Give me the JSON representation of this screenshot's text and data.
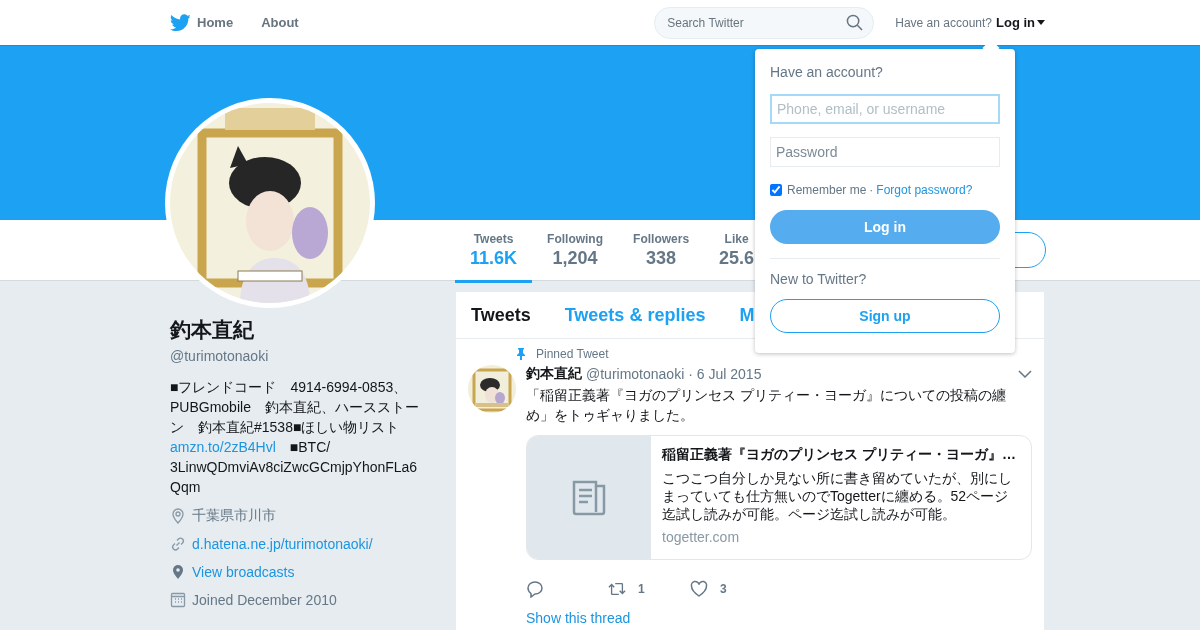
{
  "nav": {
    "links": [
      {
        "label": "Home",
        "kind": "home"
      },
      {
        "label": "About",
        "kind": "plain"
      }
    ],
    "search": {
      "placeholder": "Search Twitter"
    },
    "account_prompt": "Have an account?",
    "login_link": "Log in"
  },
  "stats": [
    {
      "label": "Tweets",
      "value": "11.6K",
      "selected": true
    },
    {
      "label": "Following",
      "value": "1,204",
      "selected": false
    },
    {
      "label": "Followers",
      "value": "338",
      "selected": false
    },
    {
      "label": "Like",
      "value": "25.6",
      "selected": false
    }
  ],
  "profile": {
    "name": "釣本直紀",
    "handle": "@turimotonaoki",
    "bio": [
      {
        "text": "■フレンドコード　4914-6994-0853、PUBGmobile　釣本直紀、ハースストーン　釣本直紀#1538■ほしい物リスト",
        "kind": "text"
      },
      {
        "text": "amzn.to/2zB4Hvl",
        "kind": "link"
      },
      {
        "text": "　■BTC/ 3LinwQDmviAv8ciZwcGCmjpYhonFLa6Qqm",
        "kind": "text"
      }
    ],
    "meta": [
      {
        "kind": "location",
        "text": "千葉県市川市"
      },
      {
        "kind": "url",
        "text": "d.hatena.ne.jp/turimotonaoki/"
      },
      {
        "kind": "broadcast",
        "text": "View broadcasts"
      },
      {
        "kind": "joined",
        "text": "Joined December 2010"
      }
    ]
  },
  "timeline_tabs": [
    {
      "label": "Tweets",
      "selected": true
    },
    {
      "label": "Tweets & replies",
      "selected": false
    },
    {
      "label": "M",
      "selected": false
    }
  ],
  "tweet": {
    "pinned_label": "Pinned Tweet",
    "name": "釣本直紀",
    "handle": "@turimotonaoki",
    "date": "· 6 Jul 2015",
    "text": "「稲留正義著『ヨガのプリンセス プリティー・ヨーガ』についての投稿の纏め」をトゥギャりました。",
    "card": {
      "title": "稲留正義著『ヨガのプリンセス プリティー・ヨーガ』…",
      "description": "こつこつ自分しか見ない所に書き留めていたが、別にしまっていても仕方無いのでTogetterに纏める。52ページ迄試し読みが可能。ページ迄試し読みが可能。",
      "domain": "togetter.com"
    },
    "actions": [
      {
        "kind": "reply"
      },
      {
        "kind": "retweet",
        "count": "1"
      },
      {
        "kind": "like",
        "count": "3"
      }
    ],
    "thread_link": "Show this thread"
  },
  "login_dropdown": {
    "heading": "Have an account?",
    "username": {
      "placeholder": "Phone, email, or username"
    },
    "password": {
      "placeholder": "Password"
    },
    "remember": {
      "label": "Remember me",
      "checked": true
    },
    "separator": "·",
    "forgot_link": "Forgot password?",
    "login_button": "Log in",
    "signup_prompt": "New to Twitter?",
    "signup_button": "Sign up"
  }
}
